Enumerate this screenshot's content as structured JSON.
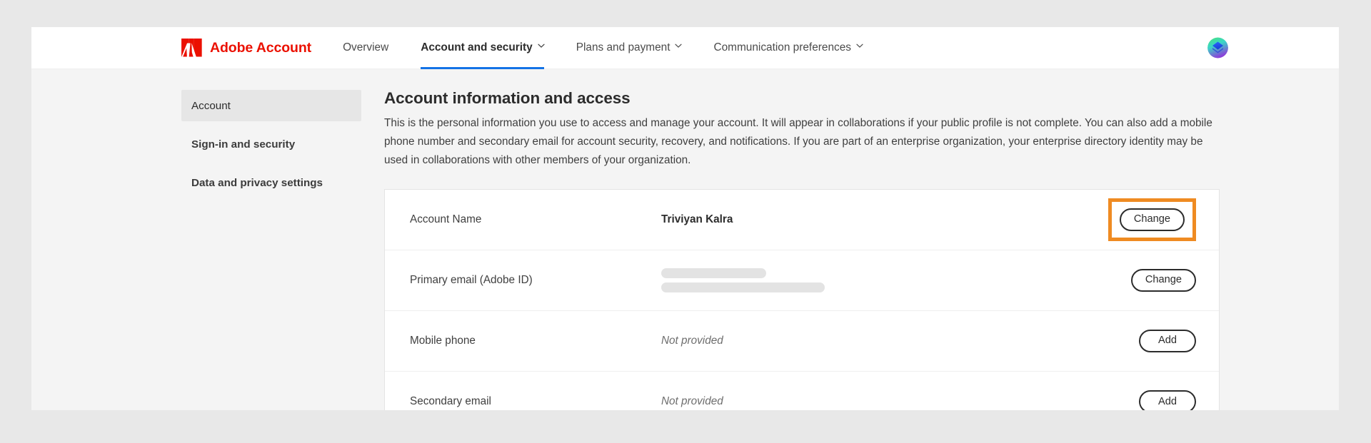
{
  "header": {
    "brand_name": "Adobe Account",
    "logo_icon": "adobe-logo-icon",
    "nav": [
      {
        "label": "Overview",
        "has_caret": false,
        "active": false
      },
      {
        "label": "Account and security",
        "has_caret": true,
        "active": true
      },
      {
        "label": "Plans and payment",
        "has_caret": true,
        "active": false
      },
      {
        "label": "Communication preferences",
        "has_caret": true,
        "active": false
      }
    ],
    "avatar_icon": "user-avatar-icon"
  },
  "sidebar": {
    "items": [
      {
        "label": "Account",
        "selected": true
      },
      {
        "label": "Sign-in and security",
        "selected": false
      },
      {
        "label": "Data and privacy settings",
        "selected": false
      }
    ]
  },
  "main": {
    "title": "Account information and access",
    "intro": "This is the personal information you use to access and manage your account. It will appear in collaborations if your public profile is not complete. You can also add a mobile phone number and secondary email for account security, recovery, and notifications. If you are part of an enterprise organization, your enterprise directory identity may be used in collaborations with other members of your organization.",
    "rows": [
      {
        "label": "Account Name",
        "value": "Triviyan Kalra",
        "value_style": "bold",
        "action": "Change",
        "highlighted": true
      },
      {
        "label": "Primary email (Adobe ID)",
        "value": "",
        "value_style": "redacted",
        "action": "Change",
        "highlighted": false
      },
      {
        "label": "Mobile phone",
        "value": "Not provided",
        "value_style": "muted",
        "action": "Add",
        "highlighted": false
      },
      {
        "label": "Secondary email",
        "value": "Not provided",
        "value_style": "muted",
        "action": "Add",
        "highlighted": false
      }
    ]
  },
  "colors": {
    "brand_red": "#eb1000",
    "accent_blue": "#1473e6",
    "highlight_orange": "#ef8b22",
    "page_background": "#e8e8e8",
    "content_background": "#f4f4f4"
  }
}
